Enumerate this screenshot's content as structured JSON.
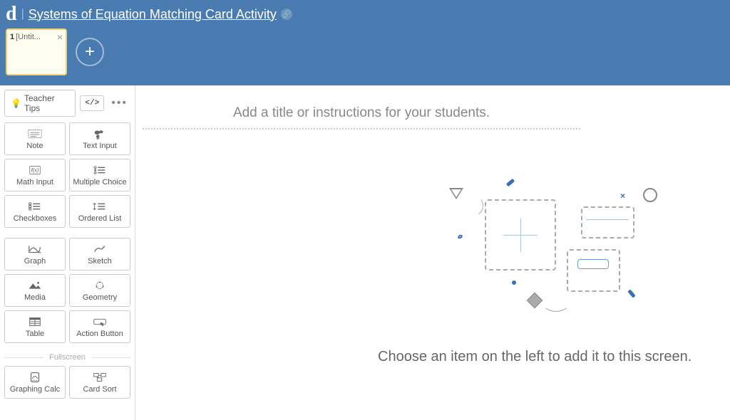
{
  "header": {
    "logo": "d",
    "title": "Systems of Equation Matching Card Activity"
  },
  "slides": {
    "current": {
      "number": "1",
      "name": "[Untit..."
    }
  },
  "sidebar": {
    "teacher_tips": "Teacher Tips",
    "components_row1": [
      {
        "id": "note",
        "label": "Note"
      },
      {
        "id": "text-input",
        "label": "Text Input"
      },
      {
        "id": "math-input",
        "label": "Math Input"
      },
      {
        "id": "multiple-choice",
        "label": "Multiple Choice"
      },
      {
        "id": "checkboxes",
        "label": "Checkboxes"
      },
      {
        "id": "ordered-list",
        "label": "Ordered List"
      }
    ],
    "components_row2": [
      {
        "id": "graph",
        "label": "Graph"
      },
      {
        "id": "sketch",
        "label": "Sketch"
      },
      {
        "id": "media",
        "label": "Media"
      },
      {
        "id": "geometry",
        "label": "Geometry"
      },
      {
        "id": "table",
        "label": "Table"
      },
      {
        "id": "action-button",
        "label": "Action Button"
      }
    ],
    "fullscreen_label": "Fullscreen",
    "components_row3": [
      {
        "id": "graphing-calc",
        "label": "Graphing Calc"
      },
      {
        "id": "card-sort",
        "label": "Card Sort"
      }
    ]
  },
  "canvas": {
    "title_placeholder": "Add a title or instructions for your students.",
    "instruction": "Choose an item on the left to add it to this screen."
  }
}
